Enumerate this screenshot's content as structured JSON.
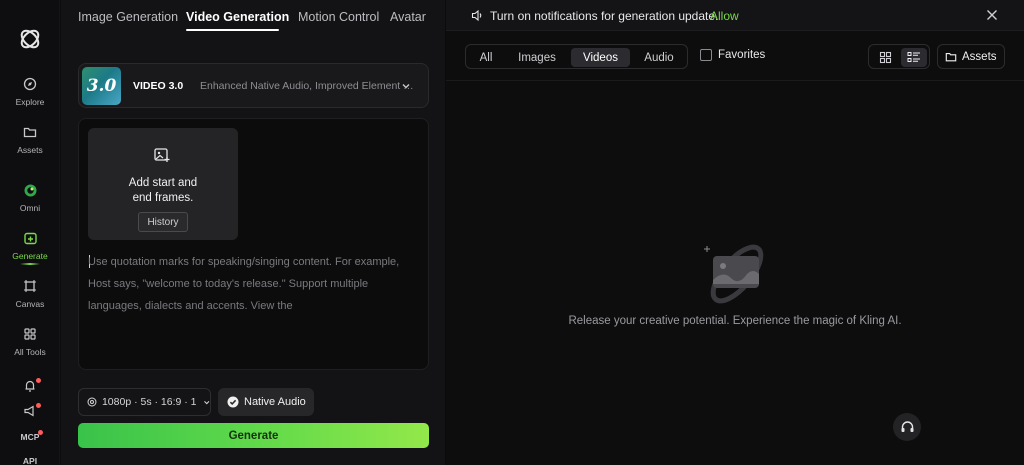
{
  "rail": {
    "items": [
      {
        "label": "Explore",
        "icon": "compass-icon"
      },
      {
        "label": "Assets",
        "icon": "folder-icon"
      },
      {
        "label": "Omni",
        "icon": "omni-icon"
      },
      {
        "label": "Generate",
        "icon": "generate-icon",
        "active": true
      },
      {
        "label": "Canvas",
        "icon": "canvas-icon"
      },
      {
        "label": "All Tools",
        "icon": "grid-icon"
      },
      {
        "label": "",
        "icon": "bell-icon"
      },
      {
        "label": "",
        "icon": "megaphone-icon"
      },
      {
        "label": "MCP",
        "icon": "mcp-icon"
      },
      {
        "label": "API",
        "icon": "api-icon"
      }
    ]
  },
  "tabs": [
    {
      "label": "Image Generation"
    },
    {
      "label": "Video Generation",
      "active": true
    },
    {
      "label": "Motion Control"
    },
    {
      "label": "Avatar"
    }
  ],
  "model": {
    "badge": "3.0",
    "name": "VIDEO 3.0",
    "description": "Enhanced Native Audio, Improved Element Con..."
  },
  "frames": {
    "line1": "Add start and",
    "line2": "end frames.",
    "history_label": "History"
  },
  "prompt": {
    "placeholder": "Use quotation marks for speaking/singing content. For example, Host says, \"welcome to today's release.\" Support multiple languages, dialects and accents. View the"
  },
  "settings": {
    "summary": "1080p · 5s · 16:9 · 1",
    "native_audio_label": "Native Audio"
  },
  "generate_label": "Generate",
  "notification": {
    "text": "Turn on notifications for generation update.",
    "allow_label": "Allow"
  },
  "filters": {
    "items": [
      "All",
      "Images",
      "Videos",
      "Audio"
    ],
    "active": "Videos",
    "favorites_label": "Favorites",
    "assets_label": "Assets"
  },
  "empty_state": {
    "message": "Release your creative potential. Experience the magic of Kling AI."
  },
  "colors": {
    "accent": "#7bd94a",
    "generate_gradient_start": "#39c24a",
    "generate_gradient_end": "#93e84a",
    "background": "#0b0b0c"
  }
}
